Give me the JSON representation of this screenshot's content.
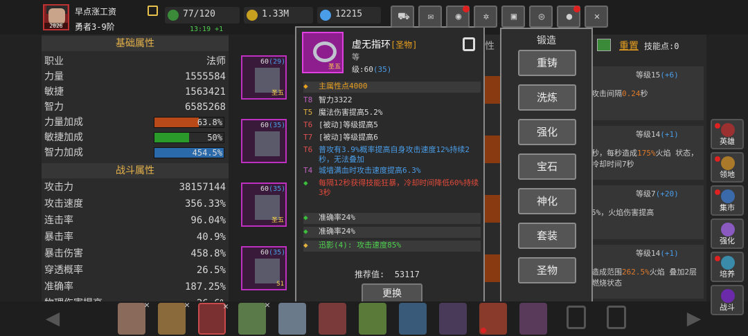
{
  "player": {
    "name": "早点涨工资",
    "rank": "勇者3-9阶",
    "avatar_year": "2026"
  },
  "resources": {
    "energy": "77/120",
    "gold": "1.33M",
    "gems": "12215",
    "timer": "13:19 +1"
  },
  "toolbar": [
    "cart-icon",
    "mail-icon",
    "gamepad-icon",
    "gear-icon",
    "gift-icon",
    "wheel-icon",
    "bomb-icon",
    "swords-icon"
  ],
  "basic": {
    "title": "基础属性",
    "rows": [
      {
        "k": "职业",
        "v": "法师"
      },
      {
        "k": "力量",
        "v": "1555584"
      },
      {
        "k": "敏捷",
        "v": "1563421"
      },
      {
        "k": "智力",
        "v": "6585268"
      }
    ],
    "bonus": [
      {
        "k": "力量加成",
        "v": "63.8%",
        "pct": 0.638,
        "color": "#b84a1a"
      },
      {
        "k": "敏捷加成",
        "v": "50%",
        "pct": 0.5,
        "color": "#2a9a2a"
      },
      {
        "k": "智力加成",
        "v": "454.5%",
        "pct": 1.0,
        "color": "#2a6aaa"
      }
    ]
  },
  "combat": {
    "title": "战斗属性",
    "rows": [
      {
        "k": "攻击力",
        "v": "38157144"
      },
      {
        "k": "攻击速度",
        "v": "356.33%"
      },
      {
        "k": "连击率",
        "v": "96.04%"
      },
      {
        "k": "暴击率",
        "v": "40.9%"
      },
      {
        "k": "暴击伤害",
        "v": "458.8%"
      },
      {
        "k": "穿透概率",
        "v": "26.5%"
      },
      {
        "k": "准确率",
        "v": "187.25%"
      },
      {
        "k": "物理伤害提高",
        "v": "26.6%"
      }
    ]
  },
  "slots": [
    {
      "lv": "60",
      "star": "(29)",
      "tier": "圣五"
    },
    {
      "lv": "60",
      "star": "(35)",
      "tier": ""
    },
    {
      "lv": "60",
      "star": "(35)",
      "tier": "圣五"
    },
    {
      "lv": "60",
      "star": "(35)",
      "tier": "S1"
    }
  ],
  "item": {
    "name": "虚无指环",
    "quality": "[圣物]",
    "label": "等",
    "level_prefix": "级:60",
    "level_bonus": "(35)",
    "tier": "圣五",
    "attrs": [
      {
        "tag": "",
        "text": "主属性点4000",
        "color": "#e8a020",
        "hl": true
      },
      {
        "tag": "T8",
        "text": "智力3322",
        "color": "#dcdcdc",
        "tagc": "#c060c0"
      },
      {
        "tag": "T5",
        "text": "魔法伤害提高5.2%",
        "color": "#dcdcdc",
        "tagc": "#e0b040"
      },
      {
        "tag": "T6",
        "text": "[被动]等级提高5",
        "color": "#dcdcdc",
        "tagc": "#e05050"
      },
      {
        "tag": "T7",
        "text": "[被动]等级提高6",
        "color": "#dcdcdc",
        "tagc": "#e05050"
      },
      {
        "tag": "T6",
        "text": "普攻有3.9%概率提高自身攻击速度12%持续2秒，无法叠加",
        "color": "#4a9de8",
        "tagc": "#e05050"
      },
      {
        "tag": "T4",
        "text": "城墙满血时攻击速度提高6.3%",
        "color": "#4a9de8",
        "tagc": "#c060c0"
      },
      {
        "tag": "",
        "text": "每隔12秒获得技能狂暴，冷却时间降低60%持续3秒",
        "color": "#e04a3a"
      },
      {
        "tag": "",
        "text": "准确率24%",
        "color": "#dcdcdc",
        "hl": true
      },
      {
        "tag": "",
        "text": "准确率24%",
        "color": "#dcdcdc",
        "hl": true
      },
      {
        "tag": "",
        "text": "迅影(4): 攻击速度85%",
        "color": "#4fd14f",
        "hl": true
      }
    ],
    "score_label": "推荐值:",
    "score": "53117",
    "replace": "更换"
  },
  "forge": {
    "title": "锻造",
    "buttons": [
      "重铸",
      "洗炼",
      "强化",
      "宝石",
      "神化",
      "套装",
      "圣物"
    ]
  },
  "skills": {
    "tab_partial": "性",
    "reset": "重置",
    "points": "技能点:0",
    "cards": [
      {
        "level": "等级15",
        "bonus": "(+6)",
        "desc": "攻击间隔",
        "desc_val": "0.24",
        "desc_end": "秒"
      },
      {
        "level": "等级14",
        "bonus": "(+1)",
        "desc": "秒，每秒造成",
        "desc_val": "175%",
        "desc_end": "火焰 状态，冷却时间7秒"
      },
      {
        "level": "等级7",
        "bonus": "(+20)",
        "desc": "5%，火焰伤害提高",
        "desc_val": "",
        "desc_end": ""
      },
      {
        "level": "等级14",
        "bonus": "(+1)",
        "desc": "造成范围",
        "desc_val": "262.5%",
        "desc_end": "火焰 叠加2层燃烧状态"
      }
    ]
  },
  "sidenav": [
    {
      "label": "英雄",
      "color": "#9a3030",
      "dot": true
    },
    {
      "label": "领地",
      "color": "#aa7a2a",
      "dot": true
    },
    {
      "label": "集市",
      "color": "#3a6aaa",
      "dot": true
    },
    {
      "label": "强化",
      "color": "#8a5ac0",
      "dot": false
    },
    {
      "label": "培养",
      "color": "#3a8aaa",
      "dot": true
    },
    {
      "label": "战斗",
      "color": "#6a2aaa",
      "dot": false
    }
  ],
  "heroes": [
    {
      "color": "#8a6a5a",
      "x": true,
      "dot": false
    },
    {
      "color": "#8a6a3a",
      "x": true,
      "dot": false
    },
    {
      "color": "#7a3030",
      "x": true,
      "dot": false,
      "sel": true
    },
    {
      "color": "#5a7a4a",
      "x": true,
      "dot": false
    },
    {
      "color": "#6a7a8a",
      "x": false,
      "dot": false
    },
    {
      "color": "#7a3a3a",
      "x": false,
      "dot": false
    },
    {
      "color": "#5a7a3a",
      "x": false,
      "dot": false
    },
    {
      "color": "#3a5a7a",
      "x": false,
      "dot": false
    },
    {
      "color": "#4a3a5a",
      "x": false,
      "dot": false
    },
    {
      "color": "#8a3a2a",
      "x": false,
      "dot": true
    },
    {
      "color": "#5a3a5a",
      "x": false,
      "dot": false
    }
  ]
}
